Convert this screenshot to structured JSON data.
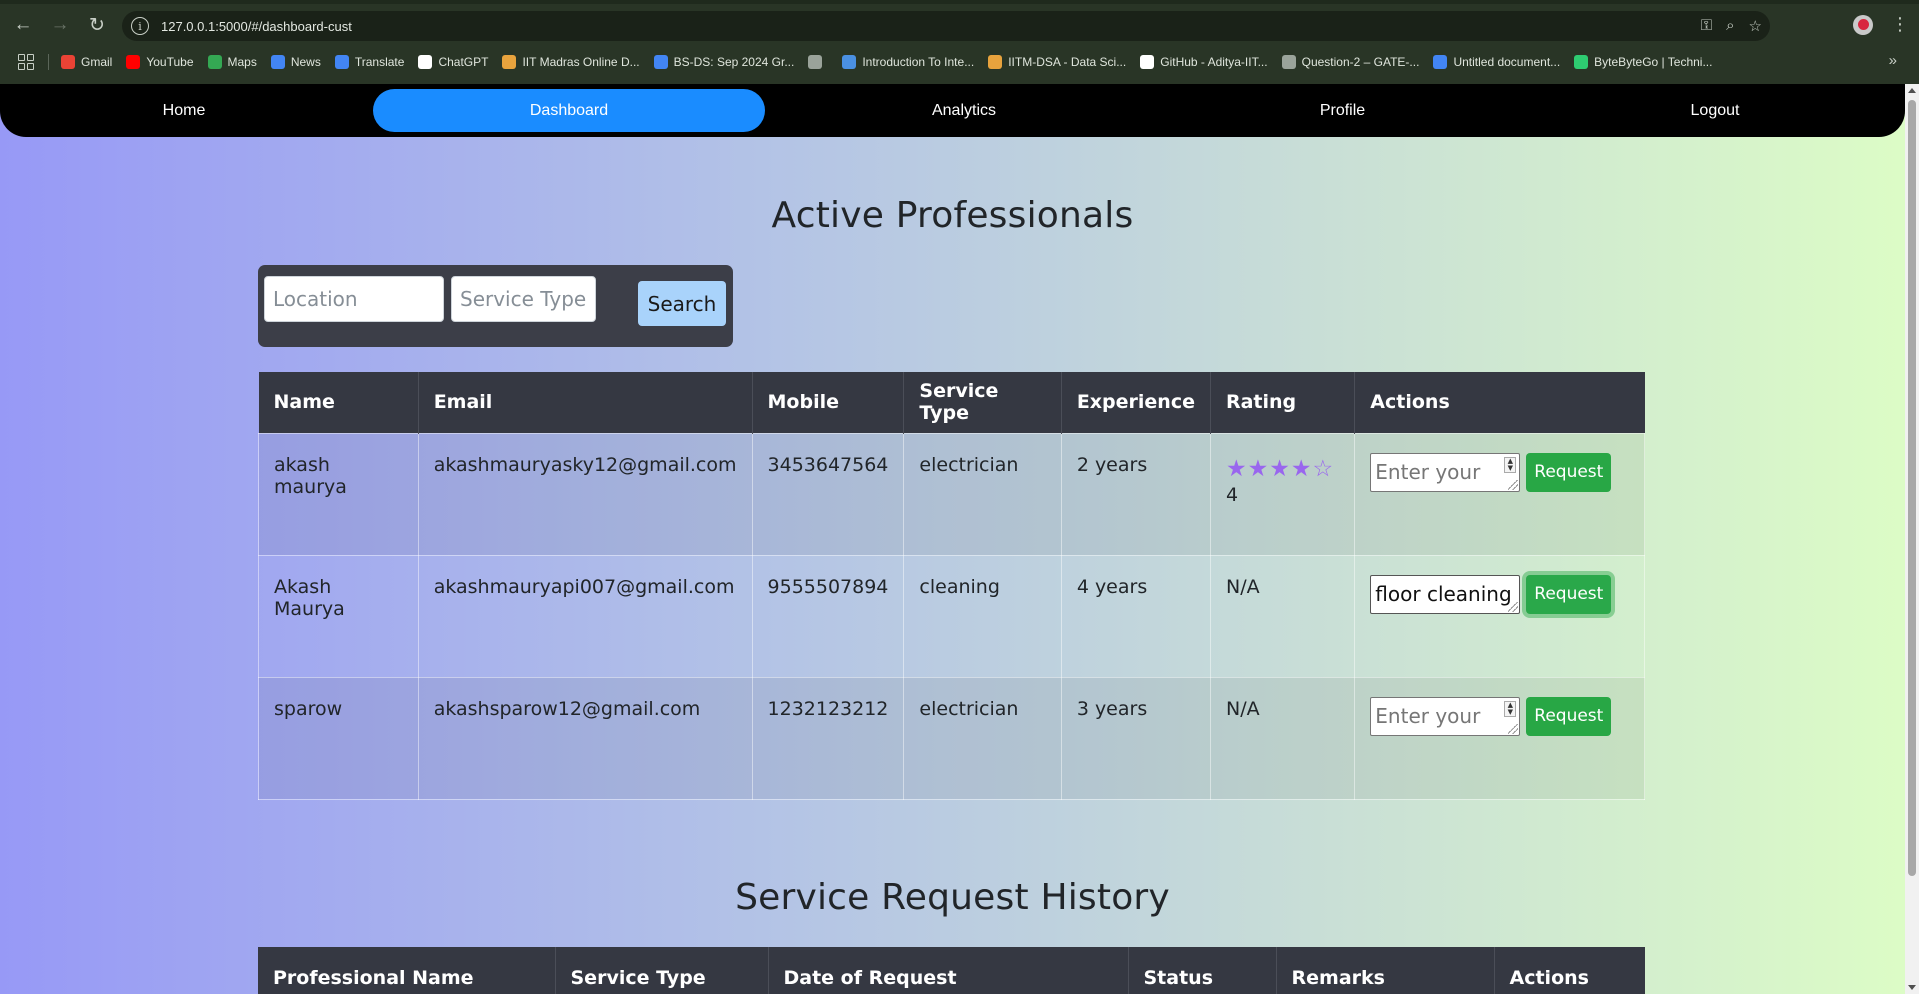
{
  "browser": {
    "url": "127.0.0.1:5000/#/dashboard-cust",
    "bookmarks": [
      {
        "label": "Gmail",
        "color": "#ea4335"
      },
      {
        "label": "YouTube",
        "color": "#ff0000"
      },
      {
        "label": "Maps",
        "color": "#34a853"
      },
      {
        "label": "News",
        "color": "#4285f4"
      },
      {
        "label": "Translate",
        "color": "#4285f4"
      },
      {
        "label": "ChatGPT",
        "color": "#ffffff"
      },
      {
        "label": "IIT Madras Online D...",
        "color": "#e8a33d"
      },
      {
        "label": "BS-DS: Sep 2024 Gr...",
        "color": "#4285f4"
      },
      {
        "label": "",
        "color": "#9aa39a"
      },
      {
        "label": "Introduction To Inte...",
        "color": "#4a90e2"
      },
      {
        "label": "IITM-DSA - Data Sci...",
        "color": "#e8a33d"
      },
      {
        "label": "GitHub - Aditya-IIT...",
        "color": "#ffffff"
      },
      {
        "label": "Question-2 – GATE-...",
        "color": "#9aa39a"
      },
      {
        "label": "Untitled document...",
        "color": "#4285f4"
      },
      {
        "label": "ByteByteGo | Techni...",
        "color": "#2ecc71"
      }
    ]
  },
  "nav": {
    "home": "Home",
    "dashboard": "Dashboard",
    "analytics": "Analytics",
    "profile": "Profile",
    "logout": "Logout"
  },
  "professionals": {
    "title": "Active Professionals",
    "search": {
      "location_placeholder": "Location",
      "service_type_placeholder": "Service Type",
      "button": "Search"
    },
    "columns": [
      "Name",
      "Email",
      "Mobile",
      "Service Type",
      "Experience",
      "Rating",
      "Actions"
    ],
    "rows": [
      {
        "name": "akash maurya",
        "email": "akashmauryasky12@gmail.com",
        "mobile": "3453647564",
        "service_type": "electrician",
        "experience": "2 years",
        "rating_stars": "★★★★☆",
        "rating": "4",
        "remark_value": "",
        "remark_placeholder": "Enter your",
        "action": "Request"
      },
      {
        "name": "Akash Maurya",
        "email": "akashmauryapi007@gmail.com",
        "mobile": "9555507894",
        "service_type": "cleaning",
        "experience": "4 years",
        "rating_stars": "",
        "rating": "N/A",
        "remark_value": "floor cleaning",
        "remark_placeholder": "",
        "action": "Request"
      },
      {
        "name": "sparow",
        "email": "akashsparow12@gmail.com",
        "mobile": "1232123212",
        "service_type": "electrician",
        "experience": "3 years",
        "rating_stars": "",
        "rating": "N/A",
        "remark_value": "",
        "remark_placeholder": "Enter your",
        "action": "Request"
      }
    ]
  },
  "history": {
    "title": "Service Request History",
    "columns": [
      "Professional Name",
      "Service Type",
      "Date of Request",
      "Status",
      "Remarks",
      "Actions"
    ]
  },
  "colors": {
    "active_nav": "#1a8cff",
    "request_button": "#28a745",
    "star": "#9966ee",
    "table_header": "#353842"
  }
}
